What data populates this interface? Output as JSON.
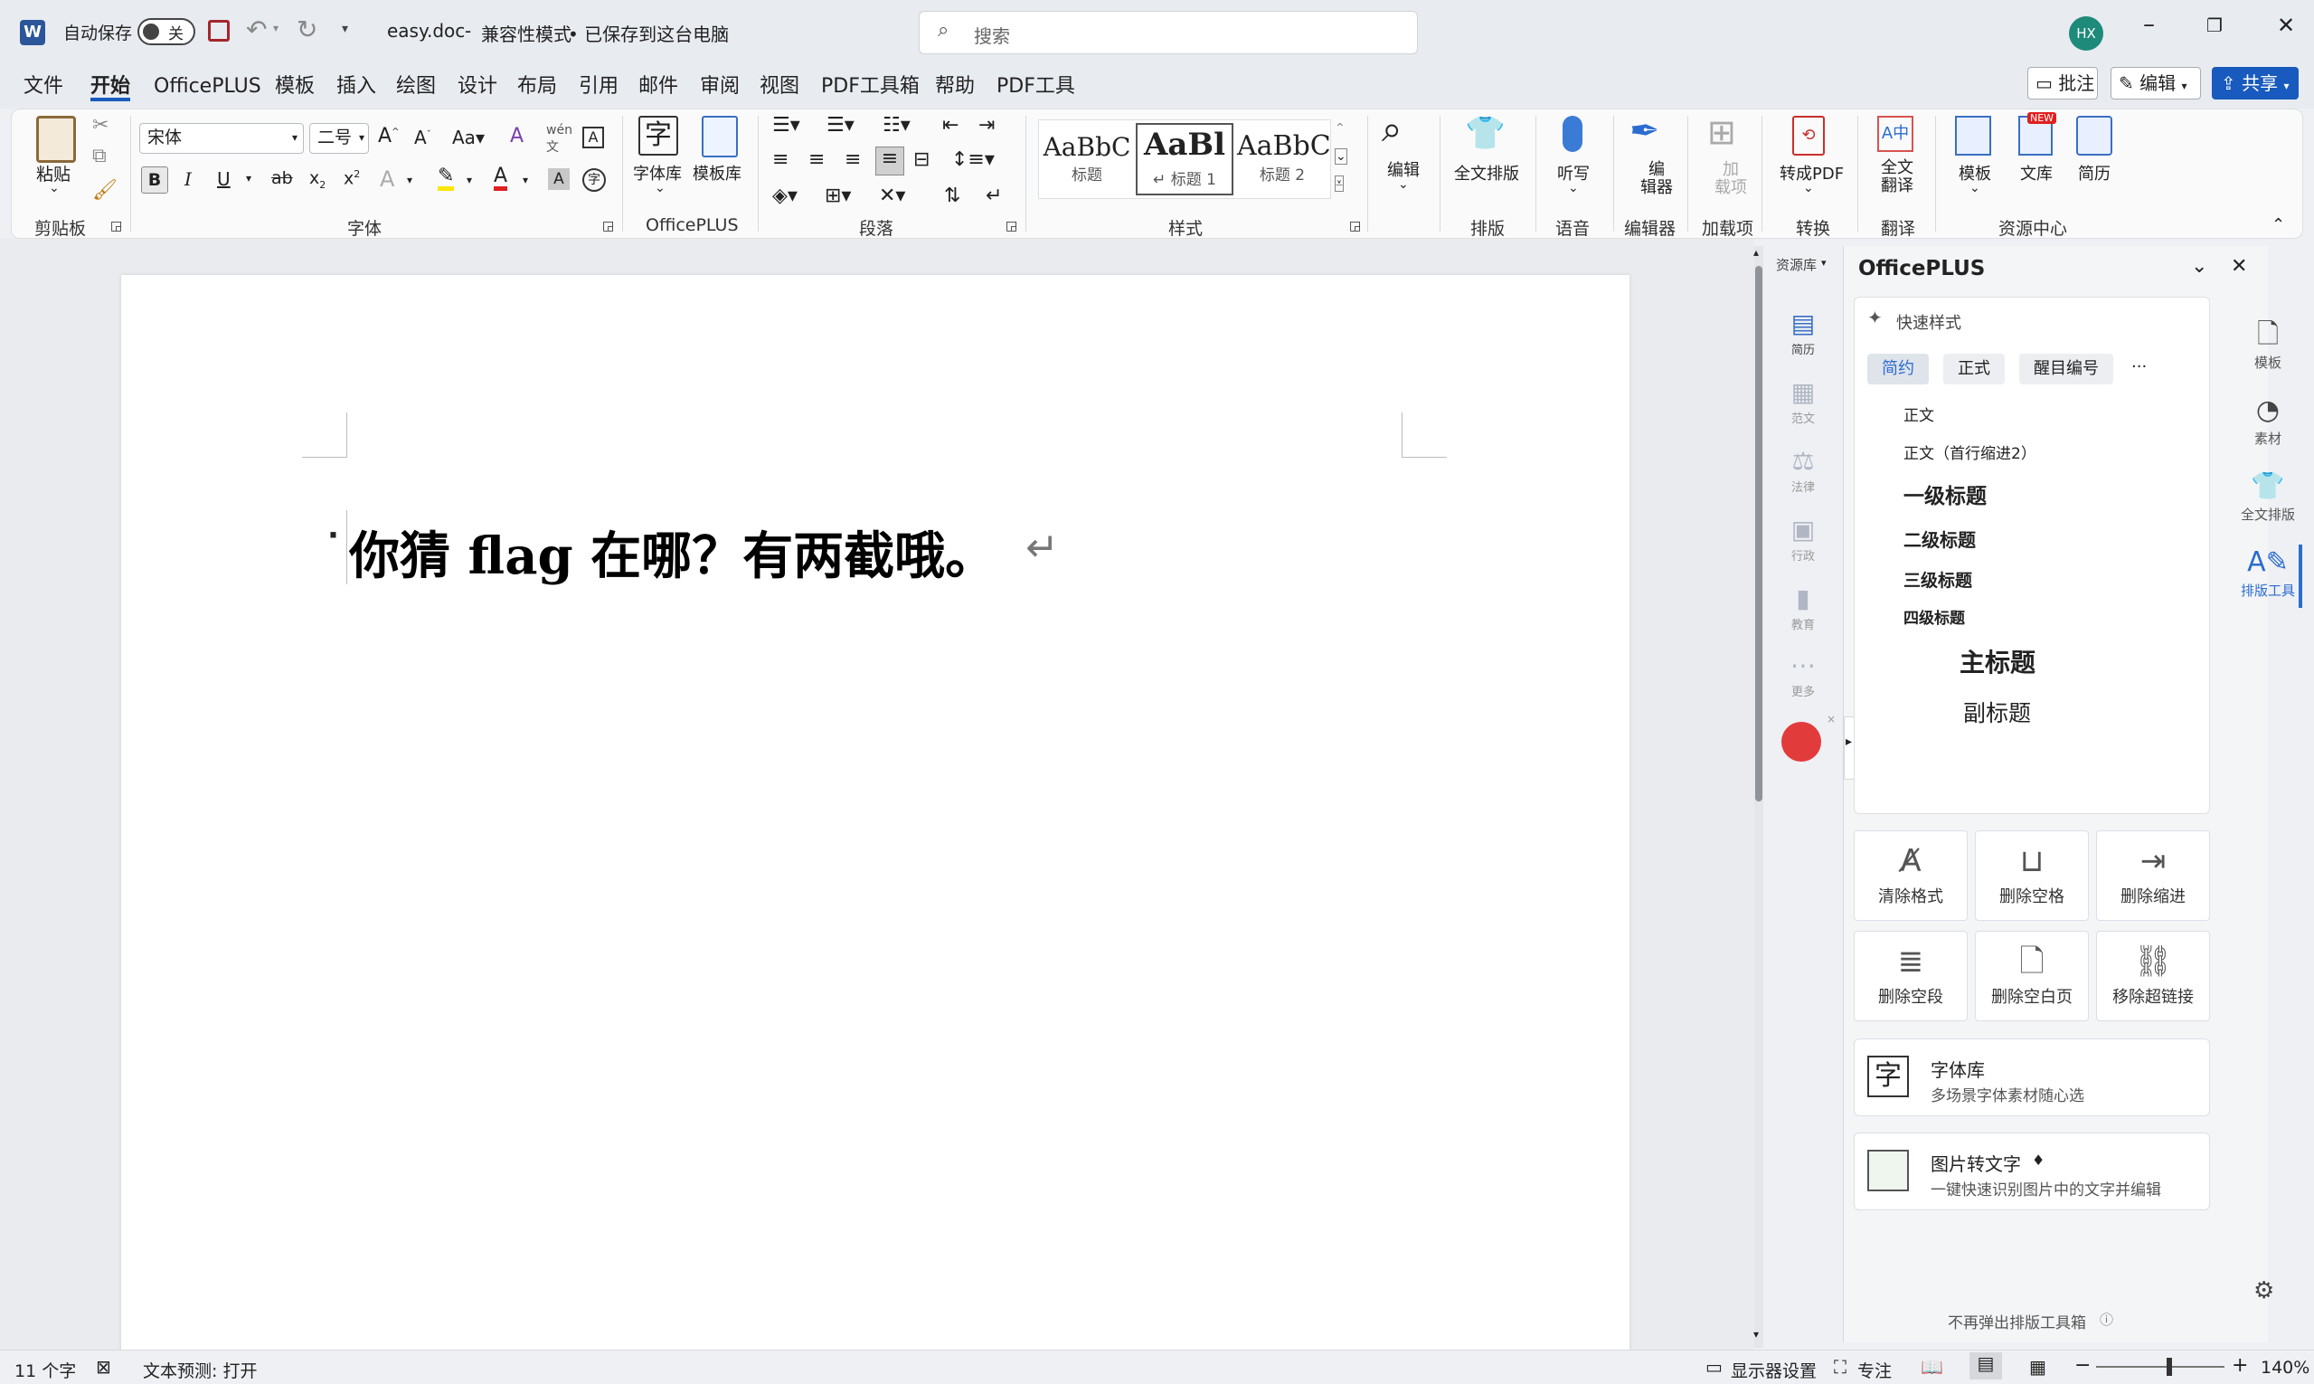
{
  "titlebar": {
    "autosave_label": "自动保存",
    "autosave_state": "关",
    "filename": "easy.doc",
    "separator": "-",
    "mode": "兼容性模式",
    "save_status": "• 已保存到这台电脑",
    "search_placeholder": "搜索",
    "avatar_initials": "HX"
  },
  "tabs": [
    "文件",
    "开始",
    "OfficePLUS",
    "模板",
    "插入",
    "绘图",
    "设计",
    "布局",
    "引用",
    "邮件",
    "审阅",
    "视图",
    "PDF工具箱",
    "帮助",
    "PDF工具"
  ],
  "tab_actions": {
    "comment": "批注",
    "edit": "编辑",
    "share": "共享"
  },
  "ribbon": {
    "paste": "粘贴",
    "font_name": "宋体",
    "font_size": "二号",
    "font_library": "字体库",
    "template_library": "模板库",
    "styles": [
      {
        "preview": "AaBbC",
        "label": "标题"
      },
      {
        "preview": "AaBl",
        "label": "↵ 标题 1"
      },
      {
        "preview": "AaBbC",
        "label": "标题 2"
      }
    ],
    "edit": "编辑",
    "full_layout": "全文排版",
    "dictate": "听写",
    "editor": "编\n辑器",
    "addins": "加\n载项",
    "to_pdf": "转成PDF",
    "translate": "全文\n翻译",
    "template": "模板",
    "library": "文库",
    "library_badge": "NEW",
    "resume": "简历",
    "groups": {
      "clipboard": "剪贴板",
      "font": "字体",
      "officeplus": "OfficePLUS",
      "paragraph": "段落",
      "styles": "样式",
      "layout": "排版",
      "voice": "语音",
      "editor": "编辑器",
      "addins": "加载项",
      "convert": "转换",
      "translate": "翻译",
      "resources": "资源中心"
    }
  },
  "document": {
    "text": "你猜 flag 在哪？有两截哦。"
  },
  "resource_strip": {
    "header": "资源库",
    "items": [
      "简历",
      "范文",
      "法律",
      "行政",
      "教育",
      "更多"
    ]
  },
  "panel": {
    "title": "OfficePLUS",
    "quick_styles": "快速样式",
    "style_tabs": [
      "简约",
      "正式",
      "醒目编号"
    ],
    "more": "···",
    "styles": [
      "正文",
      "正文（首行缩进2）",
      "一级标题",
      "二级标题",
      "三级标题",
      "四级标题",
      "主标题",
      "副标题"
    ],
    "tools": [
      "清除格式",
      "删除空格",
      "删除缩进",
      "删除空段",
      "删除空白页",
      "移除超链接"
    ],
    "font_lib_title": "字体库",
    "font_lib_desc": "多场景字体素材随心选",
    "img2text_title": "图片转文字",
    "img2text_desc": "一键快速识别图片中的文字并编辑",
    "footer": "不再弹出排版工具箱"
  },
  "rightrail": [
    "模板",
    "素材",
    "全文排版",
    "排版工具"
  ],
  "statusbar": {
    "word_count": "11 个字",
    "text_predict": "文本预测: 打开",
    "display_settings": "显示器设置",
    "focus": "专注",
    "zoom": "140%"
  },
  "colors": {
    "accent": "#185abd",
    "word_blue": "#2b579a",
    "highlight_yellow": "#ffe600",
    "font_red": "#e02020"
  }
}
